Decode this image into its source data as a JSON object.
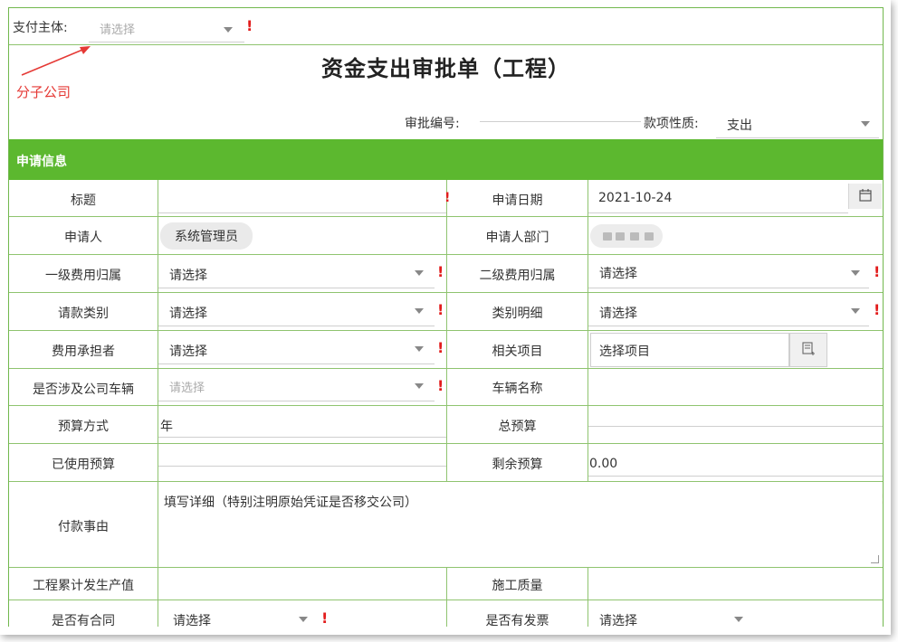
{
  "header": {
    "pay_entity_label": "支付主体:",
    "pay_entity_placeholder": "请选择",
    "annotation_text": "分子公司",
    "form_title": "资金支出审批单（工程）",
    "approval_no_label": "审批编号:",
    "payment_type_label": "款项性质:",
    "payment_type_value": "支出"
  },
  "section": {
    "title": "申请信息"
  },
  "fields": {
    "title_label": "标题",
    "apply_date_label": "申请日期",
    "apply_date_value": "2021-10-24",
    "applicant_label": "申请人",
    "applicant_value": "系统管理员",
    "applicant_dept_label": "申请人部门",
    "level1_cost_label": "一级费用归属",
    "level2_cost_label": "二级费用归属",
    "request_category_label": "请款类别",
    "category_detail_label": "类别明细",
    "cost_bearer_label": "费用承担者",
    "related_project_label": "相关项目",
    "related_project_placeholder": "选择项目",
    "company_vehicle_label": "是否涉及公司车辆",
    "vehicle_name_label": "车辆名称",
    "budget_method_label": "预算方式",
    "budget_method_value": "年",
    "total_budget_label": "总预算",
    "used_budget_label": "已使用预算",
    "remaining_budget_label": "剩余预算",
    "remaining_budget_value": "0.00",
    "payment_reason_label": "付款事由",
    "payment_reason_placeholder": "填写详细（特别注明原始凭证是否移交公司）",
    "project_output_label": "工程累计发生产值",
    "construction_quality_label": "施工质量",
    "has_contract_label": "是否有合同",
    "has_invoice_label": "是否有发票",
    "select_placeholder": "请选择",
    "required_mark": "!"
  },
  "colors": {
    "section_green": "#5cb82f",
    "border_green": "#8fc46f",
    "required_red": "#e21c1c",
    "annotation_red": "#e53935"
  }
}
